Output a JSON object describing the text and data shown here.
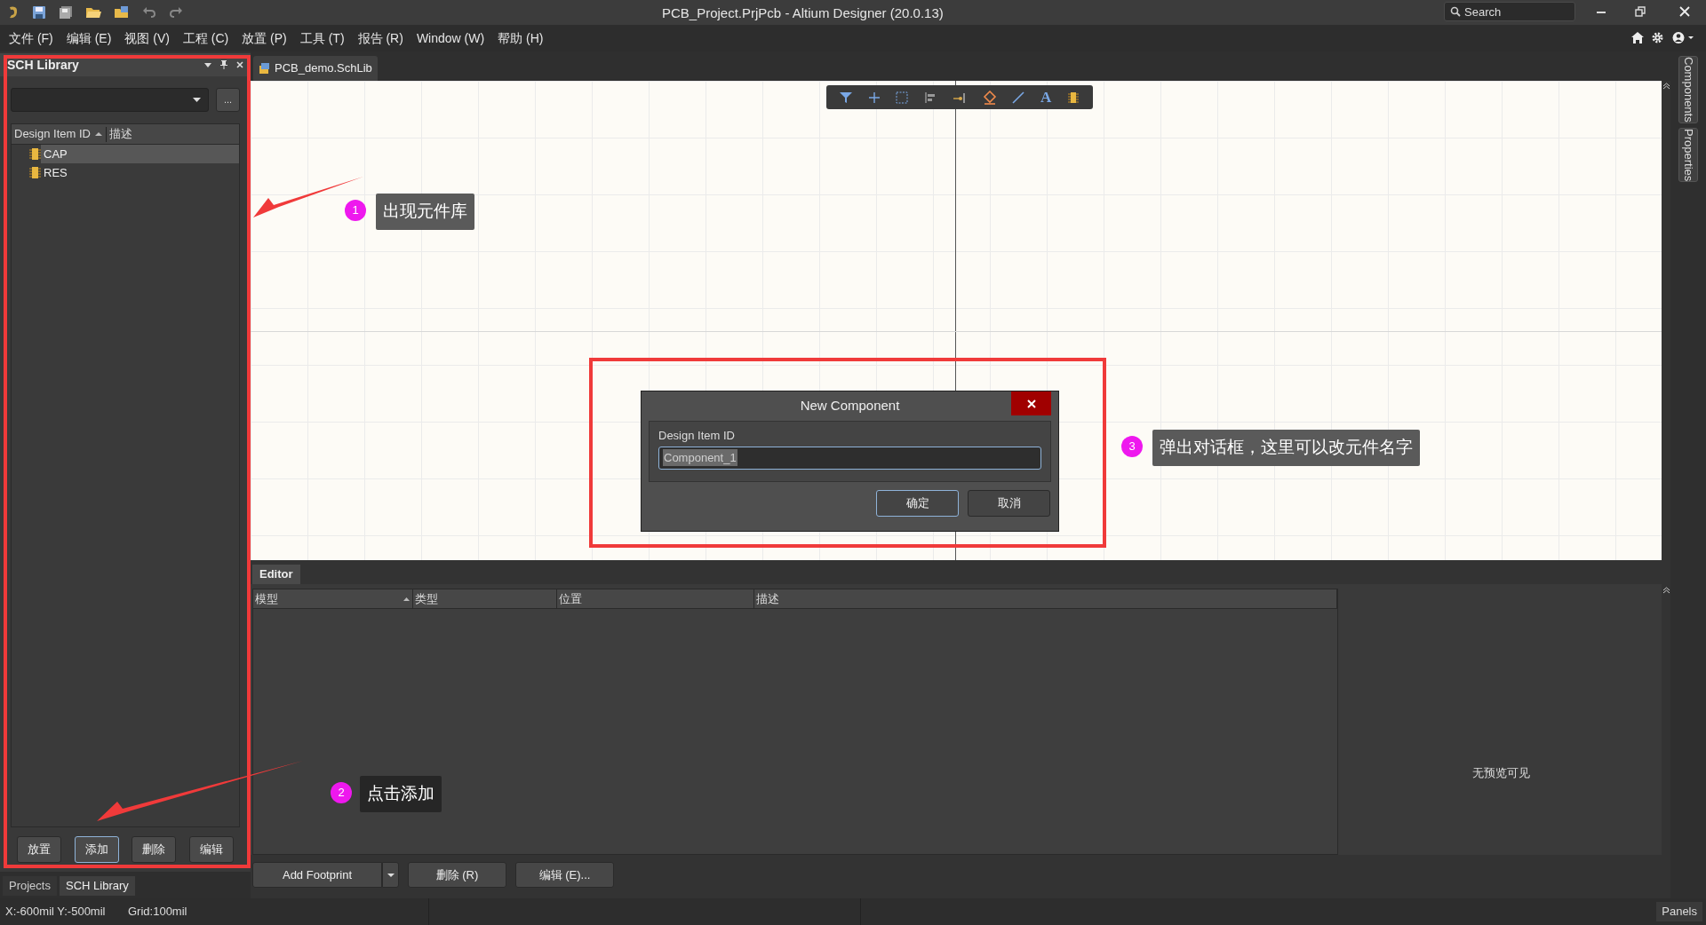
{
  "title_bar": {
    "title": "PCB_Project.PrjPcb - Altium Designer (20.0.13)",
    "search": {
      "placeholder": "Search"
    }
  },
  "menu": [
    "文件 (F)",
    "编辑 (E)",
    "视图 (V)",
    "工程 (C)",
    "放置 (P)",
    "工具 (T)",
    "报告 (R)",
    "Window (W)",
    "帮助 (H)"
  ],
  "left_panel": {
    "title": "SCH Library",
    "browse_button": "...",
    "columns": [
      "Design Item ID",
      "描述"
    ],
    "items": [
      {
        "label": "CAP",
        "selected": true
      },
      {
        "label": "RES",
        "selected": false
      }
    ],
    "buttons": [
      {
        "label": "放置",
        "selected": false
      },
      {
        "label": "添加",
        "selected": true
      },
      {
        "label": "删除",
        "selected": false
      },
      {
        "label": "编辑",
        "selected": false
      }
    ]
  },
  "panel_tabs": [
    {
      "label": "Projects",
      "selected": false
    },
    {
      "label": "SCH Library",
      "selected": true
    }
  ],
  "document_tab": "PCB_demo.SchLib",
  "canvas_toolbar": {
    "text_tool": "A"
  },
  "right_tabs": [
    "Components",
    "Properties"
  ],
  "dialog": {
    "title": "New Component",
    "field_label": "Design Item ID",
    "value": "Component_1",
    "buttons": [
      "确定",
      "取消"
    ]
  },
  "editor": {
    "tab": "Editor",
    "columns": [
      "模型",
      "类型",
      "位置",
      "描述"
    ],
    "preview": "无预览可见",
    "buttons": [
      "Add Footprint",
      "删除 (R)",
      "编辑 (E)..."
    ]
  },
  "status_bar": [
    "X:-600mil Y:-500mil",
    "Grid:100mil",
    "Panels"
  ],
  "annotations": [
    {
      "number": "1",
      "text": "出现元件库"
    },
    {
      "number": "2",
      "text": "点击添加"
    },
    {
      "number": "3",
      "text": "弹出对话框，这里可以改元件名字"
    }
  ]
}
